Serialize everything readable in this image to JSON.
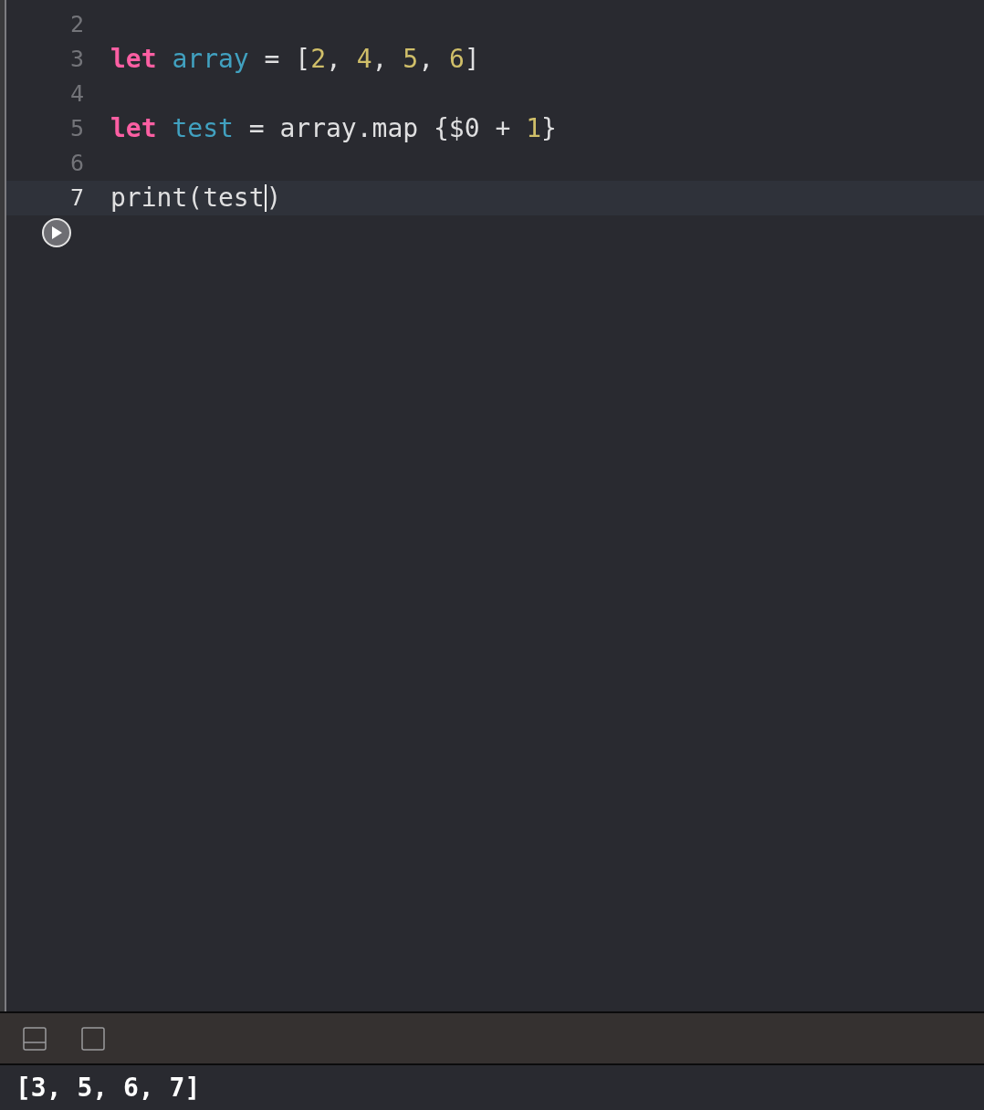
{
  "editor": {
    "lines": [
      {
        "number": "2",
        "current": false
      },
      {
        "number": "3",
        "current": false,
        "tokens": [
          {
            "kind": "keyword",
            "text": "let"
          },
          {
            "kind": "identifier",
            "text": "array"
          },
          {
            "kind": "plain",
            "text": " = ["
          },
          {
            "kind": "number",
            "text": "2"
          },
          {
            "kind": "plain",
            "text": ", "
          },
          {
            "kind": "number",
            "text": "4"
          },
          {
            "kind": "plain",
            "text": ", "
          },
          {
            "kind": "number",
            "text": "5"
          },
          {
            "kind": "plain",
            "text": ", "
          },
          {
            "kind": "number",
            "text": "6"
          },
          {
            "kind": "plain",
            "text": "]"
          }
        ]
      },
      {
        "number": "4",
        "current": false
      },
      {
        "number": "5",
        "current": false,
        "tokens": [
          {
            "kind": "keyword",
            "text": "let"
          },
          {
            "kind": "identifier",
            "text": "test"
          },
          {
            "kind": "plain",
            "text": " = array.map {$0 + "
          },
          {
            "kind": "number",
            "text": "1"
          },
          {
            "kind": "plain",
            "text": "}"
          }
        ]
      },
      {
        "number": "6",
        "current": false
      },
      {
        "number": "7",
        "current": true,
        "tokens": [
          {
            "kind": "plain",
            "text": "print(test",
            "caret_after": true
          },
          {
            "kind": "plain",
            "text": ")"
          }
        ]
      }
    ]
  },
  "console": {
    "output": "[3, 5, 6, 7]"
  }
}
